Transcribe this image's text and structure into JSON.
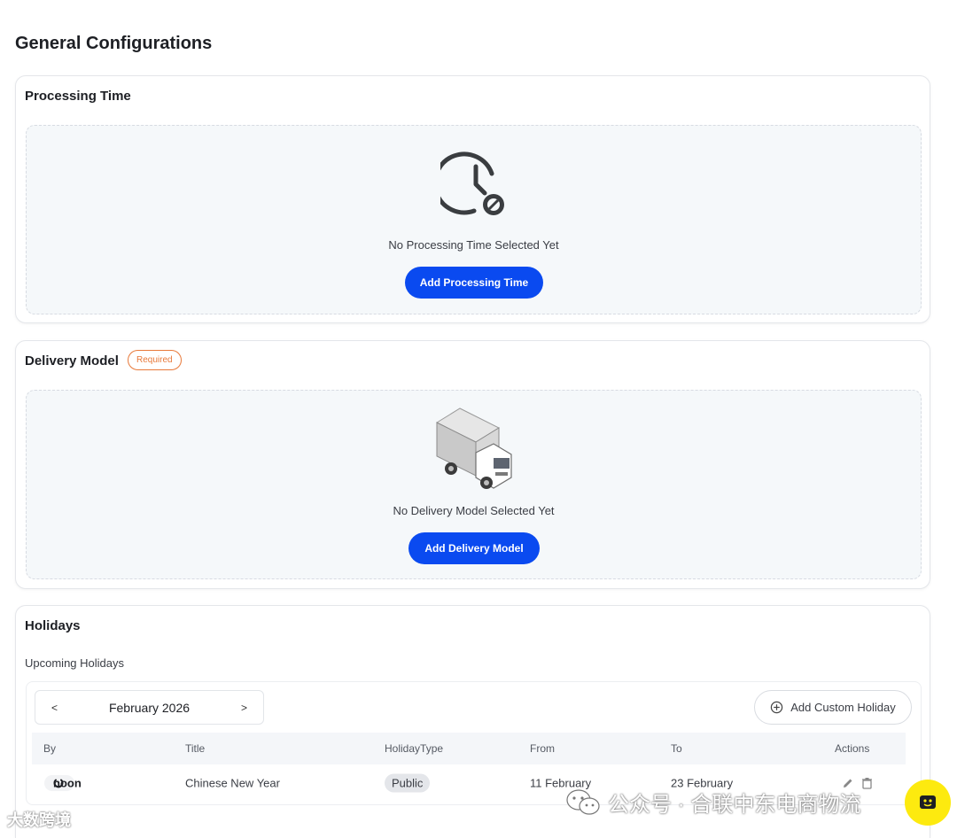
{
  "page_title": "General Configurations",
  "processing": {
    "title": "Processing Time",
    "empty_text": "No Processing Time Selected Yet",
    "button": "Add Processing Time"
  },
  "delivery": {
    "title": "Delivery Model",
    "badge": "Required",
    "empty_text": "No Delivery Model Selected Yet",
    "button": "Add Delivery Model"
  },
  "holidays": {
    "title": "Holidays",
    "subtitle": "Upcoming Holidays",
    "month_label": "February 2026",
    "prev": "<",
    "next": ">",
    "add_button": "Add Custom Holiday",
    "columns": [
      "By",
      "Title",
      "HolidayType",
      "From",
      "To",
      "Actions"
    ],
    "rows": [
      {
        "by": "noon",
        "title": "Chinese New Year",
        "type": "Public",
        "from": "11 February",
        "to": "23 February"
      }
    ]
  },
  "watermarks": {
    "left": "大数跨境",
    "right": "公众号 · 合联中东电商物流"
  },
  "colors": {
    "primary": "#0a4af0",
    "required": "#e8793a",
    "empty_bg": "#f5f8fa",
    "chat_fab": "#fdea0f"
  },
  "icons": [
    "clock-slash-icon",
    "truck-icon",
    "plus-circle-icon",
    "edit-icon",
    "trash-icon",
    "wechat-icon",
    "chat-icon"
  ]
}
